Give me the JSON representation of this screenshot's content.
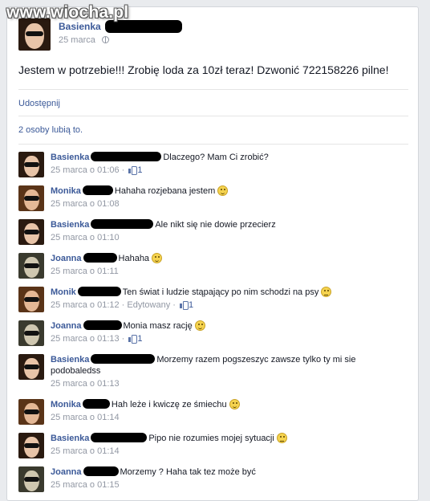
{
  "watermark": "www.wiocha.pl",
  "post": {
    "author": "Basienka",
    "date": "25 marca",
    "text": "Jestem w potrzebie!!! Zrobię loda za 10zł teraz! Dzwonić 722158226 pilne!",
    "share_label": "Udostępnij",
    "likes_label": "2 osoby lubią to."
  },
  "comments": [
    {
      "author": "Basienka",
      "text": "Dlaczego? Mam Ci zrobić?",
      "time": "25 marca o 01:06",
      "likes": "1",
      "edited": ""
    },
    {
      "author": "Monika",
      "text": "Hahaha rozjebana jestem",
      "time": "25 marca o 01:08",
      "likes": "",
      "edited": ""
    },
    {
      "author": "Basienka",
      "text": "Ale nikt się nie dowie przecierz",
      "time": "25 marca o 01:10",
      "likes": "",
      "edited": ""
    },
    {
      "author": "Joanna",
      "text": "Hahaha",
      "time": "25 marca o 01:11",
      "likes": "",
      "edited": ""
    },
    {
      "author": "Monik",
      "text": "Ten świat i ludzie stąpający po nim schodzi na psy",
      "time": "25 marca o 01:12",
      "likes": "1",
      "edited": "Edytowany"
    },
    {
      "author": "Joanna",
      "text": "Monia masz rację",
      "time": "25 marca o 01:13",
      "likes": "1",
      "edited": ""
    },
    {
      "author": "Basienka",
      "text": "Morzemy razem pogszeszyc zawsze tylko ty mi sie podobaledss",
      "time": "25 marca o 01:13",
      "likes": "",
      "edited": ""
    },
    {
      "author": "Monika",
      "text": "Hah leże i kwiczę ze śmiechu",
      "time": "25 marca o 01:14",
      "likes": "",
      "edited": ""
    },
    {
      "author": "Basienka",
      "text": "Pipo nie rozumies mojej sytuacji",
      "time": "25 marca o 01:14",
      "likes": "",
      "edited": ""
    },
    {
      "author": "Joanna",
      "text": "Morzemy ? Haha tak tez może być",
      "time": "25 marca o 01:15",
      "likes": "",
      "edited": ""
    }
  ],
  "meta_separator": " · ",
  "colors": {
    "link": "#3b5998",
    "meta": "#9197a3",
    "background": "#e9ebee"
  }
}
